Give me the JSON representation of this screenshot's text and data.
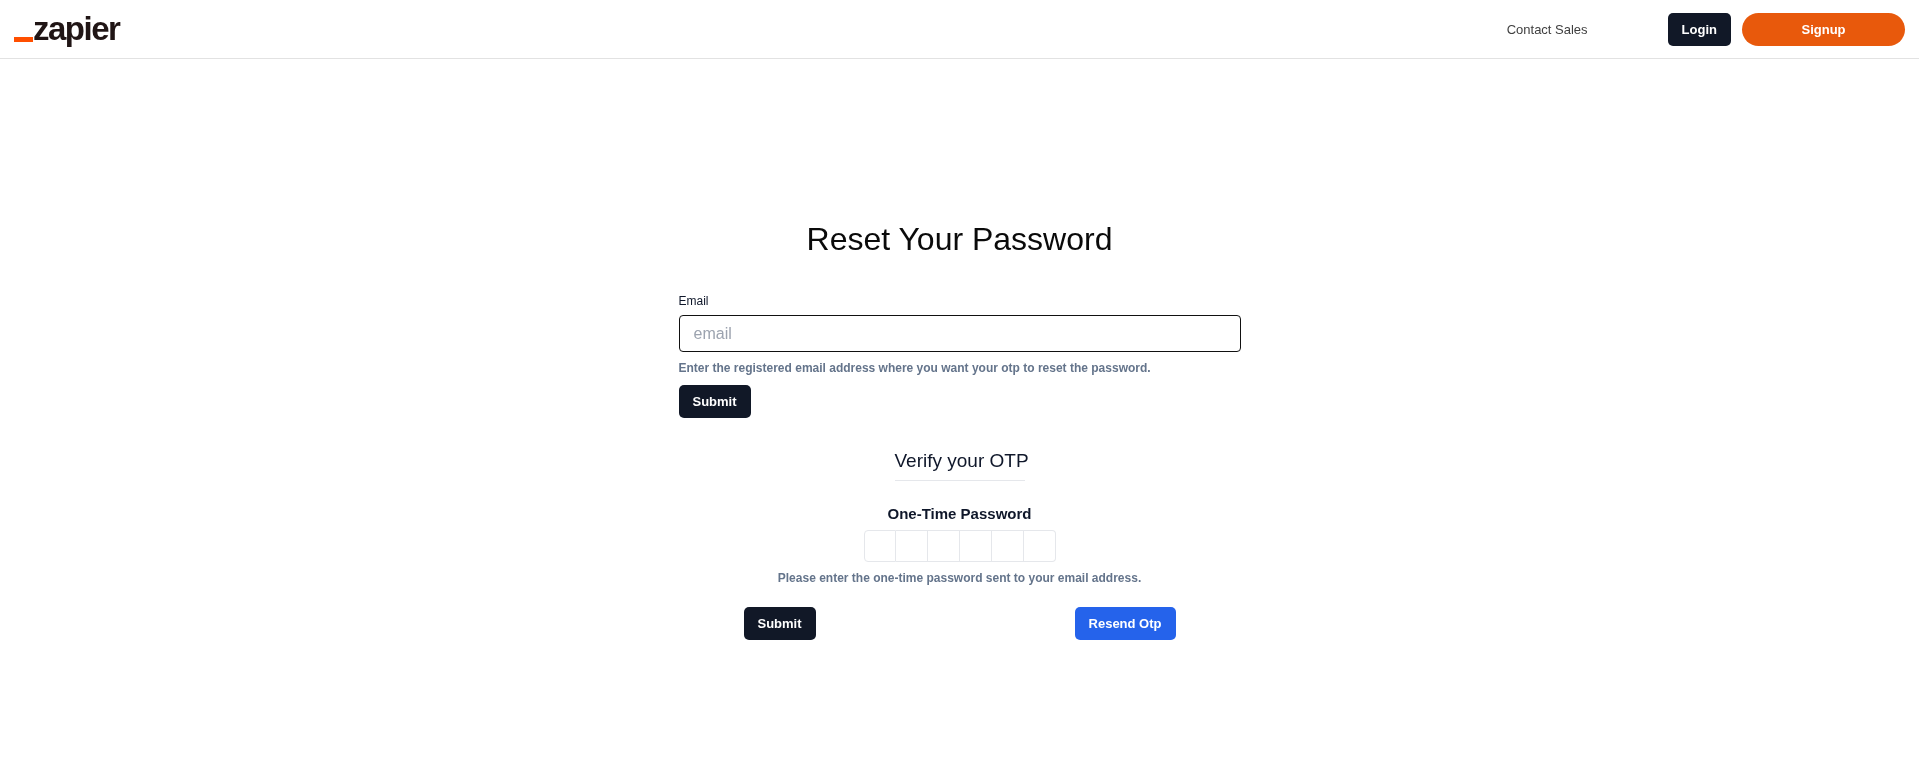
{
  "header": {
    "logo": "zapier",
    "links": [
      {
        "label": "Contact Sales"
      }
    ],
    "buttons": [
      {
        "label": "Login",
        "kind": "dark"
      },
      {
        "label": "Signup",
        "kind": "accent"
      }
    ]
  },
  "reset_form": {
    "title": "Reset Your Password",
    "email_label": "Email",
    "email_placeholder": "email",
    "hint": "Enter the registered email address where you want your otp to reset the password.",
    "submit": "Submit"
  },
  "otp_form": {
    "title": "Verify your OTP",
    "label": "One-Time Password",
    "boxes": [
      {
        "focused": false
      },
      {
        "focused": false
      },
      {
        "focused": false
      },
      {
        "focused": false
      },
      {
        "focused": false
      },
      {
        "focused": false
      }
    ],
    "hint": "Please enter the one-time password sent to your email address.",
    "buttons": [
      {
        "label": "Submit",
        "kind": "dark"
      },
      {
        "label": "Resend Otp",
        "kind": "primary"
      }
    ]
  }
}
